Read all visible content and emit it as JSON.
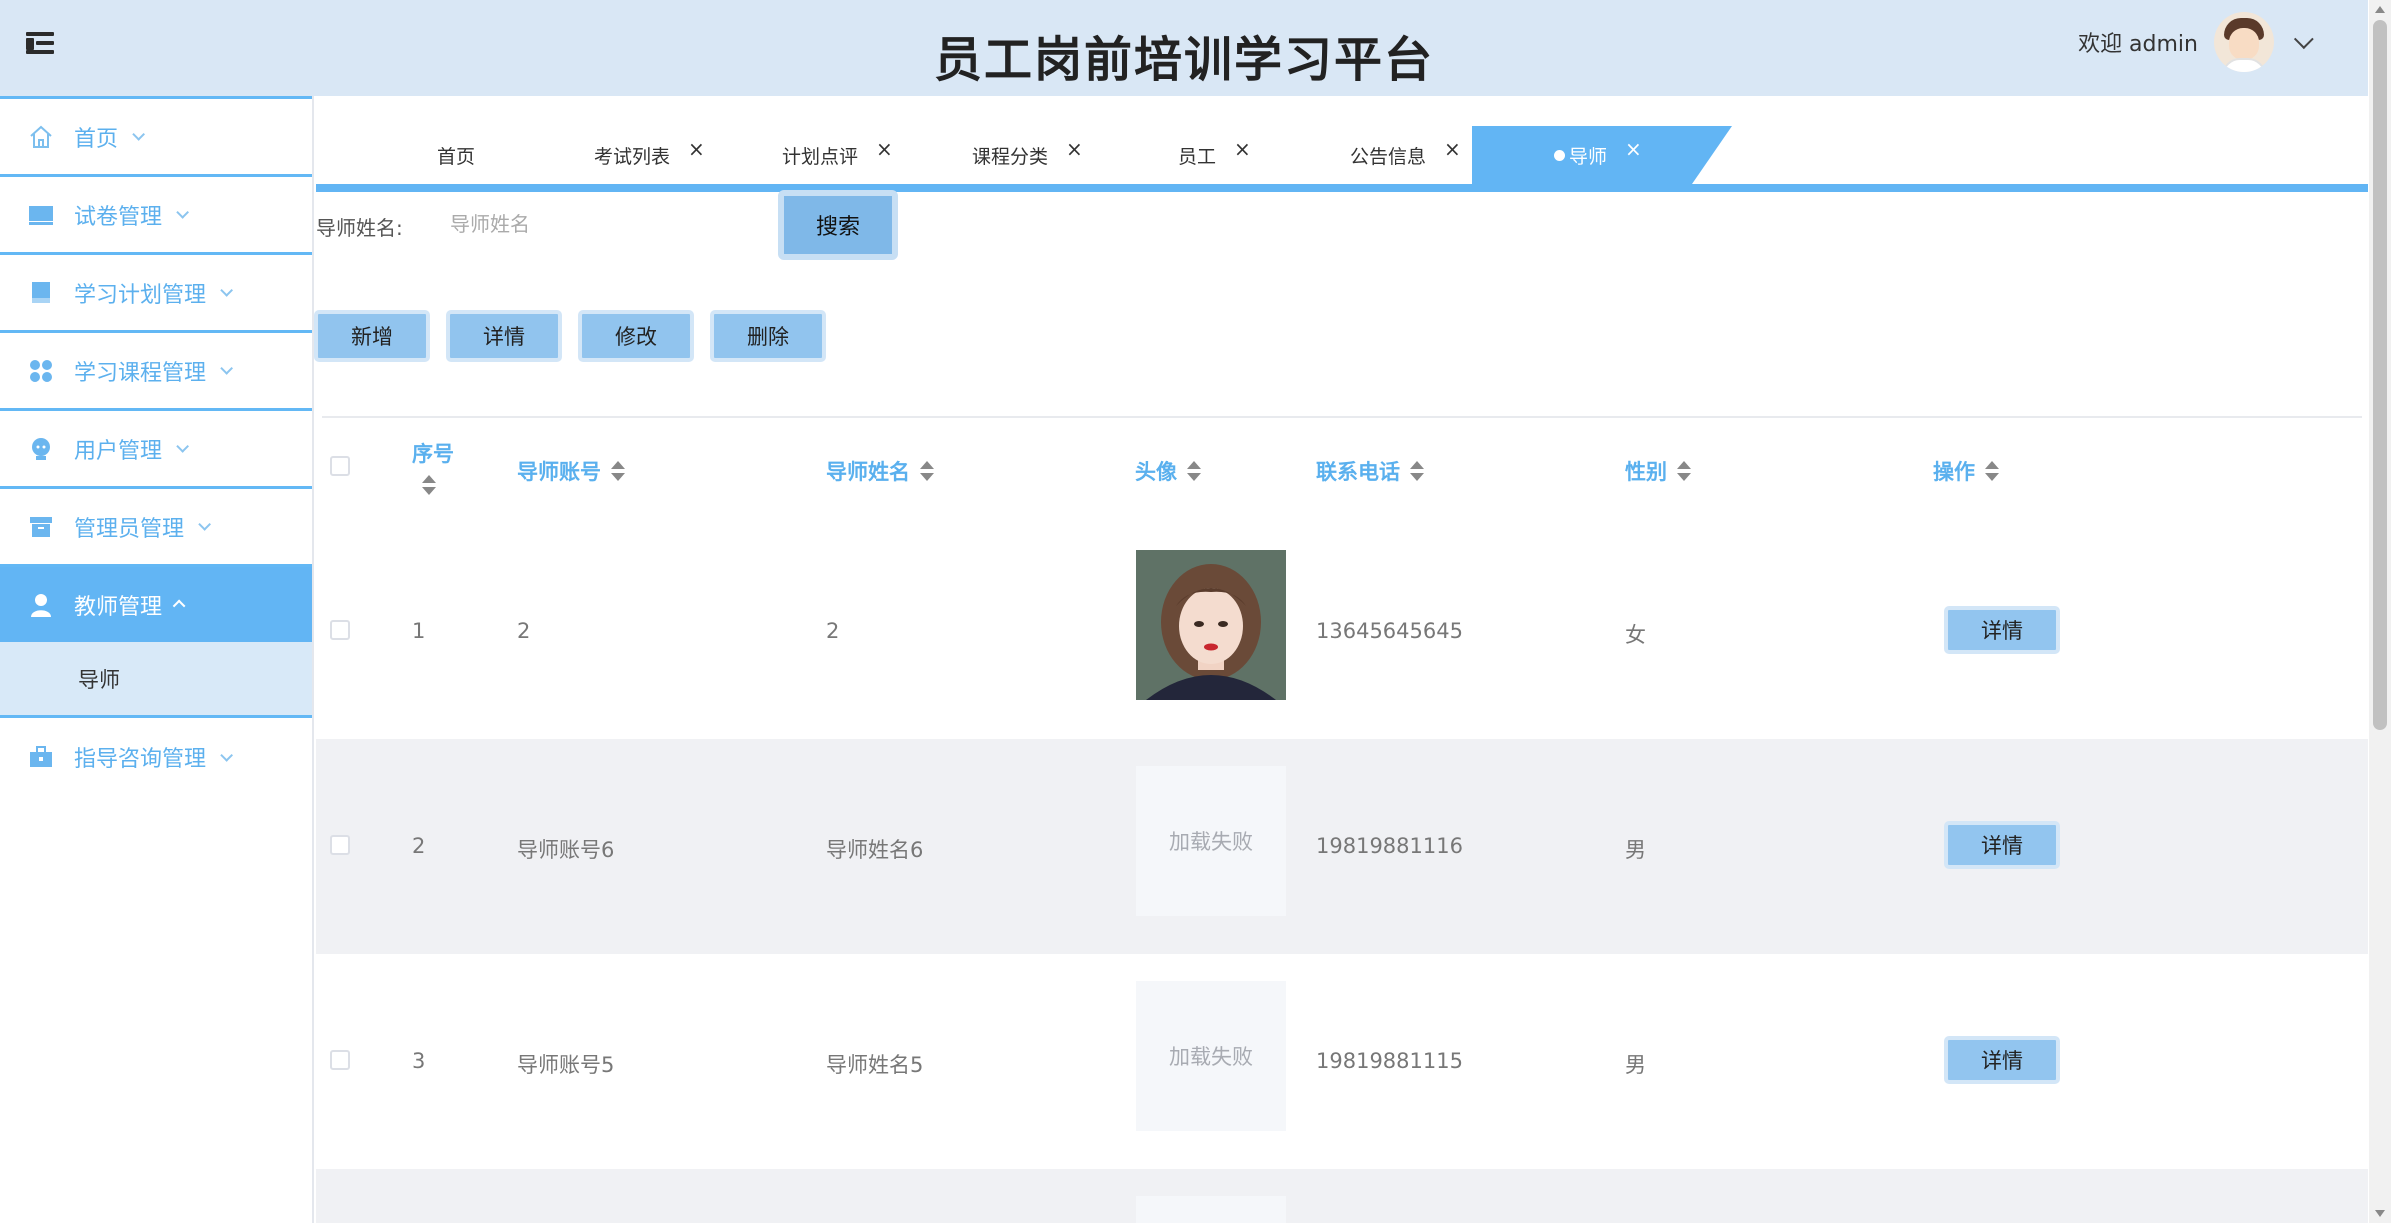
{
  "header": {
    "title": "员工岗前培训学习平台",
    "welcome": "欢迎 admin"
  },
  "sidebar": {
    "items": [
      {
        "label": "首页",
        "icon": "home-icon"
      },
      {
        "label": "试卷管理",
        "icon": "monitor-icon"
      },
      {
        "label": "学习计划管理",
        "icon": "book-icon"
      },
      {
        "label": "学习课程管理",
        "icon": "grid-icon"
      },
      {
        "label": "用户管理",
        "icon": "user-face-icon"
      },
      {
        "label": "管理员管理",
        "icon": "archive-icon"
      },
      {
        "label": "教师管理",
        "icon": "person-icon",
        "active": true,
        "sub": [
          "导师"
        ]
      },
      {
        "label": "指导咨询管理",
        "icon": "briefcase-icon"
      }
    ]
  },
  "tabs": [
    {
      "label": "首页",
      "closable": false
    },
    {
      "label": "考试列表",
      "closable": true
    },
    {
      "label": "计划点评",
      "closable": true
    },
    {
      "label": "课程分类",
      "closable": true
    },
    {
      "label": "员工",
      "closable": true
    },
    {
      "label": "公告信息",
      "closable": true
    },
    {
      "label": "导师",
      "closable": true,
      "active": true
    }
  ],
  "search": {
    "label": "导师姓名:",
    "placeholder": "导师姓名",
    "button": "搜索"
  },
  "actions": [
    "新增",
    "详情",
    "修改",
    "删除"
  ],
  "table": {
    "columns": [
      "序号",
      "导师账号",
      "导师姓名",
      "头像",
      "联系电话",
      "性别",
      "操作"
    ],
    "rows": [
      {
        "index": "1",
        "account": "2",
        "name": "2",
        "avatar": "photo",
        "phone": "13645645645",
        "gender": "女",
        "action": "详情"
      },
      {
        "index": "2",
        "account": "导师账号6",
        "name": "导师姓名6",
        "avatar": "加载失败",
        "phone": "19819881116",
        "gender": "男",
        "action": "详情"
      },
      {
        "index": "3",
        "account": "导师账号5",
        "name": "导师姓名5",
        "avatar": "加载失败",
        "phone": "19819881115",
        "gender": "男",
        "action": "详情"
      }
    ]
  },
  "colors": {
    "accent": "#62b5f4",
    "header_bg": "#d9e7f5",
    "button": "#91c4ee"
  }
}
